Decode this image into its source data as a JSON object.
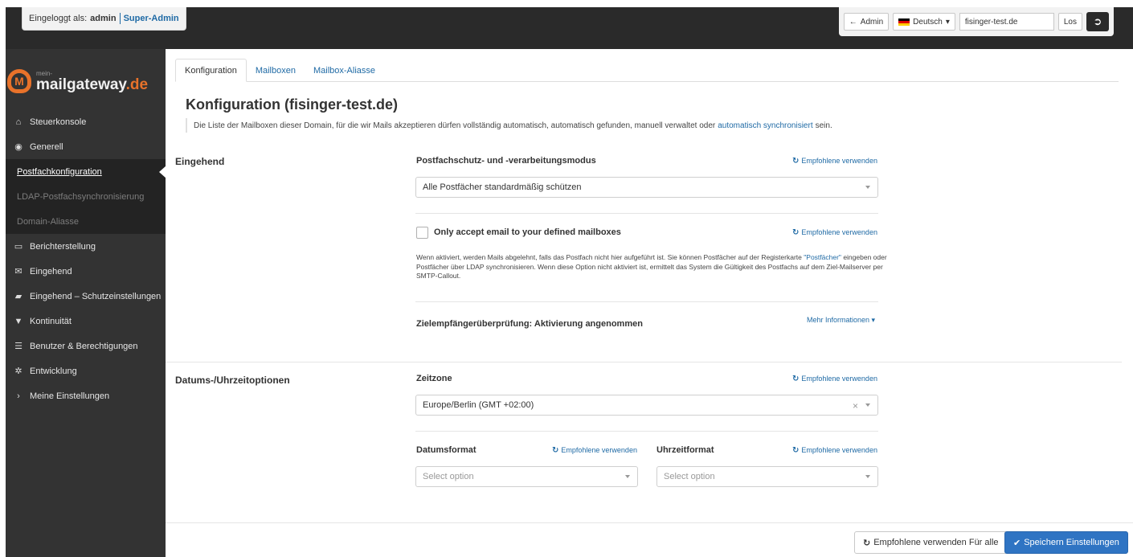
{
  "header": {
    "logged_in_prefix": "Eingeloggt als:",
    "username": "admin",
    "role": "Super-Admin",
    "admin_button": "Admin",
    "language": "Deutsch",
    "domain_value": "fisinger-test.de",
    "go_button": "Los",
    "logout_icon": "logout-icon"
  },
  "logo": {
    "small": "mein-",
    "main": "mailgateway",
    "tld": ".de"
  },
  "sidebar": {
    "items": [
      {
        "label": "Steuerkonsole",
        "icon": "⌂"
      },
      {
        "label": "Generell",
        "icon": "◉"
      },
      {
        "label": "Postfachkonfiguration"
      },
      {
        "label": "LDAP-Postfachsynchronisierung"
      },
      {
        "label": "Domain-Aliasse"
      },
      {
        "label": "Berichterstellung",
        "icon": "▭"
      },
      {
        "label": "Eingehend",
        "icon": "✉"
      },
      {
        "label": "Eingehend – Schutzeinstellungen",
        "icon": "▰"
      },
      {
        "label": "Kontinuität",
        "icon": "▼"
      },
      {
        "label": "Benutzer & Berechtigungen",
        "icon": "☰"
      },
      {
        "label": "Entwicklung",
        "icon": "✲"
      },
      {
        "label": "Meine Einstellungen",
        "icon": "›"
      }
    ]
  },
  "tabs": [
    "Konfiguration",
    "Mailboxen",
    "Mailbox-Aliasse"
  ],
  "page": {
    "title": "Konfiguration (fisinger-test.de)",
    "description": "Die Liste der Mailboxen dieser Domain, für die wir Mails akzeptieren dürfen vollständig automatisch, automatisch gefunden, manuell verwaltet oder",
    "description_link": "automatisch synchronisiert",
    "description_tail": "sein."
  },
  "incoming": {
    "section": "Eingehend",
    "mode_label": "Postfachschutz- und -verarbeitungsmodus",
    "mode_value": "Alle Postfächer standardmäßig schützen",
    "only_accept_label": "Only accept email to your defined mailboxes",
    "help_1": "Wenn aktiviert, werden Mails abgelehnt, falls das Postfach nicht hier aufgeführt ist. Sie können Postfächer auf der Registerkarte",
    "help_link": "\"Postfächer\"",
    "help_2": "eingeben oder Postfächer über LDAP synchronisieren. Wenn diese Option nicht aktiviert ist, ermittelt das System die Gültigkeit des Postfachs auf dem Ziel-Mailserver per SMTP-Callout.",
    "verification_label": "Zielempfängerüberprüfung: Aktivierung angenommen",
    "more_info": "Mehr Informationen"
  },
  "datetime": {
    "section": "Datums-/Uhrzeitoptionen",
    "timezone_label": "Zeitzone",
    "timezone_value": "Europe/Berlin (GMT +02:00)",
    "date_format_label": "Datumsformat",
    "time_format_label": "Uhrzeitformat",
    "select_placeholder": "Select option"
  },
  "recommended": "Empfohlene verwenden",
  "footer": {
    "use_recommended_all": "Empfohlene verwenden Für alle",
    "save": "Speichern Einstellungen"
  }
}
